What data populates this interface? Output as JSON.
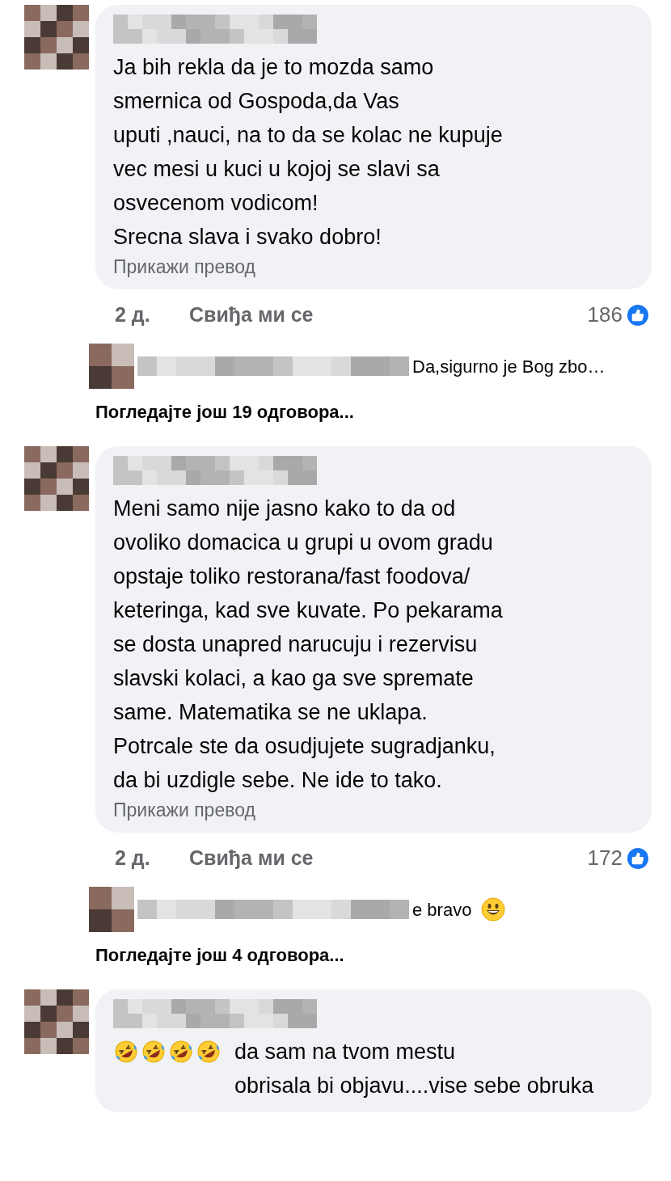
{
  "comments": [
    {
      "text": "Ja bih rekla da je to mozda samo\nsmernica od Gospoda,da Vas\nuputi ,nauci, na to da se kolac ne kupuje\nvec mesi u kuci u kojoj se slavi sa\nosvecenom vodicom!\nSrecna slava i svako dobro!",
      "translate_link": "Прикажи превод",
      "time": "2 д.",
      "like_action": "Свиђа ми се",
      "reaction_count": "186",
      "reply_preview": {
        "text": "Da,sigurno je Bog zbo…"
      },
      "more_replies": "Погледајте још 19 одговора..."
    },
    {
      "text": "Meni samo nije jasno kako to da od\novoliko domacica u grupi u ovom gradu\nopstaje toliko restorana/fast foodova/\nketeringa, kad sve kuvate. Po pekarama\nse dosta unapred narucuju i rezervisu\nslavski kolaci, a kao ga sve spremate\nsame. Matematika se ne uklapa.\nPotrcale ste da osudjujete sugradjanku,\nda bi uzdigle sebe. Ne ide to tako.",
      "translate_link": "Прикажи превод",
      "time": "2 д.",
      "like_action": "Свиђа ми се",
      "reaction_count": "172",
      "reply_preview": {
        "text": "e bravo",
        "trailing_icons": [
          {
            "kind": "grinning"
          }
        ]
      },
      "more_replies": "Погледајте још 4 одговора..."
    },
    {
      "leading_icons": [
        {
          "kind": "rolling-laughing"
        },
        {
          "kind": "rolling-laughing"
        },
        {
          "kind": "rolling-laughing"
        },
        {
          "kind": "rolling-laughing"
        }
      ],
      "text": "da sam na tvom mestu\nobrisala bi objavu....vise sebe obruka"
    }
  ]
}
